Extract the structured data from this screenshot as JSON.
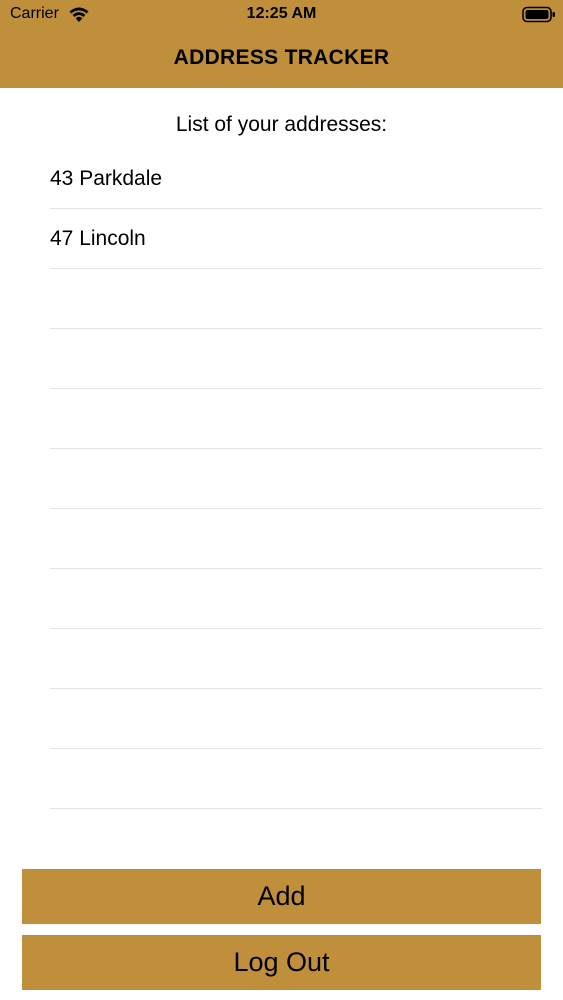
{
  "status_bar": {
    "carrier": "Carrier",
    "time": "12:25 AM",
    "icons": [
      "wifi-icon",
      "battery-icon"
    ]
  },
  "nav": {
    "title": "ADDRESS TRACKER"
  },
  "main": {
    "heading": "List of your addresses:",
    "addresses": [
      "43 Parkdale",
      "47 Lincoln",
      "",
      "",
      "",
      "",
      "",
      "",
      "",
      "",
      "",
      ""
    ]
  },
  "buttons": {
    "add_label": "Add",
    "logout_label": "Log Out"
  },
  "colors": {
    "accent": "#bf8f3b",
    "separator": "#e3e3e3"
  }
}
